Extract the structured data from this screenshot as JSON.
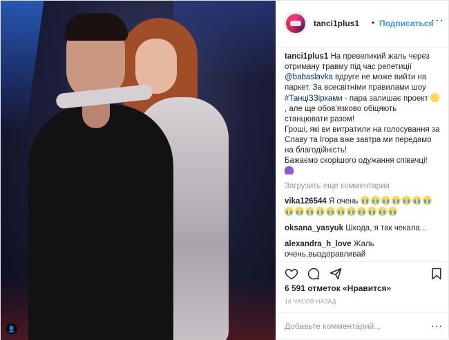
{
  "post": {
    "username": "tanci1plus1",
    "follow_label": "Подписаться",
    "separator": "•",
    "more_label": "···"
  },
  "caption": {
    "username": "tanci1plus1",
    "part1": " На превеликий жаль через отриману травму під час репетиції ",
    "mention": "@babaslavka",
    "part2": " вдруге не може вийти на паркет. За всесвітніми правилами шоу ",
    "hashtag": "#ТанціЗЗірками",
    "part3": " - пара залишає проект ",
    "part4": ", але ще обов'язково обіцяють станцювати разом!",
    "line2": "Гроші, які ви витратили на голосування за Славу та Ігора вже завтра ми передамо на благодійність!",
    "line3": "Бажаємо скорішого одужання співачці!"
  },
  "load_more_label": "Загрузить еще комментарии",
  "comments": [
    {
      "username": "vika126544",
      "text": " Я очень ",
      "emoji_count": 18
    },
    {
      "username": "oksana_yasyuk",
      "text": " Шкода, я так чекала..."
    },
    {
      "username": "alexandra_h_love",
      "text": " Жаль очень,выздоравливай"
    }
  ],
  "likes": "6 591 отметок «Нравится»",
  "time_ago": "10 ЧАСОВ НАЗАД",
  "add_comment_placeholder": "Добавьте комментарий...",
  "icons": [
    "heart-icon",
    "comment-icon",
    "share-icon",
    "bookmark-icon",
    "ellipsis-icon"
  ],
  "colors": {
    "link": "#3897f0",
    "mention": "#003569",
    "muted": "#999999"
  }
}
